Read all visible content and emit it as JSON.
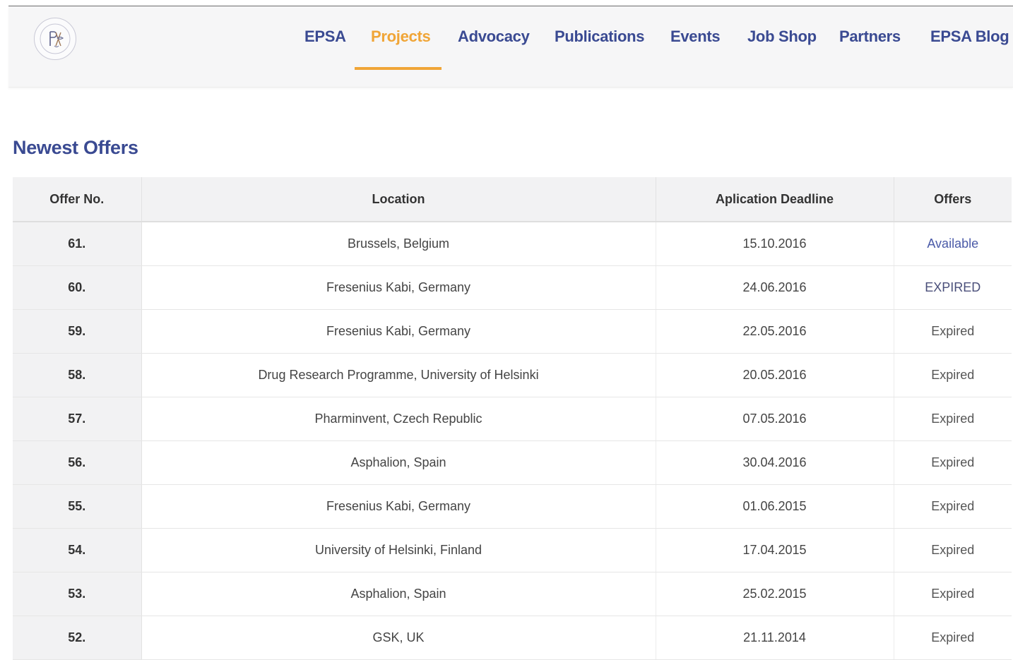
{
  "nav": {
    "items": [
      {
        "label": "EPSA",
        "active": false
      },
      {
        "label": "Projects",
        "active": true
      },
      {
        "label": "Advocacy",
        "active": false
      },
      {
        "label": "Publications",
        "active": false
      },
      {
        "label": "Events",
        "active": false
      },
      {
        "label": "Job Shop",
        "active": false
      },
      {
        "label": "Partners",
        "active": false
      },
      {
        "label": "EPSA Blog",
        "active": false
      }
    ]
  },
  "colors": {
    "brand_blue": "#3a4a92",
    "accent_orange": "#f0a537",
    "link_blue": "#4a5aa8"
  },
  "heading": "Newest Offers",
  "table": {
    "headers": [
      "Offer No.",
      "Location",
      "Aplication Deadline",
      "Offers"
    ],
    "rows": [
      {
        "no": "61.",
        "location": "Brussels, Belgium",
        "deadline": "15.10.2016",
        "status": "Available"
      },
      {
        "no": "60.",
        "location": "Fresenius Kabi, Germany",
        "deadline": "24.06.2016",
        "status": "EXPIRED"
      },
      {
        "no": "59.",
        "location": "Fresenius Kabi, Germany",
        "deadline": "22.05.2016",
        "status": "Expired"
      },
      {
        "no": "58.",
        "location": "Drug Research Programme, University of Helsinki",
        "deadline": "20.05.2016",
        "status": "Expired"
      },
      {
        "no": "57.",
        "location": "Pharminvent, Czech Republic",
        "deadline": "07.05.2016",
        "status": "Expired"
      },
      {
        "no": "56.",
        "location": "Asphalion, Spain",
        "deadline": "30.04.2016",
        "status": "Expired"
      },
      {
        "no": "55.",
        "location": "Fresenius Kabi, Germany",
        "deadline": "01.06.2015",
        "status": "Expired"
      },
      {
        "no": "54.",
        "location": "University of Helsinki, Finland",
        "deadline": "17.04.2015",
        "status": "Expired"
      },
      {
        "no": "53.",
        "location": "Asphalion, Spain",
        "deadline": "25.02.2015",
        "status": "Expired"
      },
      {
        "no": "52.",
        "location": "GSK, UK",
        "deadline": "21.11.2014",
        "status": "Expired"
      }
    ]
  }
}
